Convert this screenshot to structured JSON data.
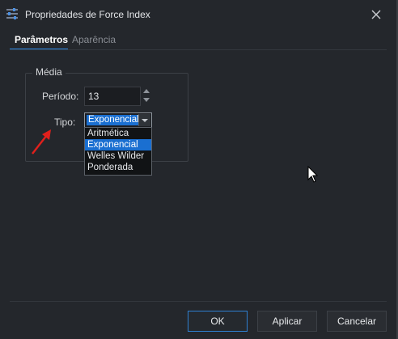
{
  "window": {
    "title": "Propriedades de Force Index"
  },
  "tabs": [
    {
      "label": "Parâmetros",
      "active": true
    },
    {
      "label": "Aparência",
      "active": false
    }
  ],
  "group": {
    "legend": "Média",
    "periodo_label": "Período:",
    "periodo_value": "13",
    "tipo_label": "Tipo:",
    "tipo_selected": "Exponencial",
    "tipo_options": [
      "Aritmética",
      "Exponencial",
      "Welles Wilder",
      "Ponderada"
    ]
  },
  "buttons": {
    "ok": "OK",
    "apply": "Aplicar",
    "cancel": "Cancelar"
  },
  "colors": {
    "accent": "#2e8ae6",
    "selection": "#1a6fd1",
    "annotation_arrow": "#e0201c"
  },
  "icons": {
    "title": "sliders-icon",
    "close": "close-icon",
    "spin_up": "chevron-up-icon",
    "spin_down": "chevron-down-icon",
    "combo": "caret-down-icon",
    "pointer": "mouse-pointer-icon",
    "annotation": "red-arrow-icon"
  }
}
